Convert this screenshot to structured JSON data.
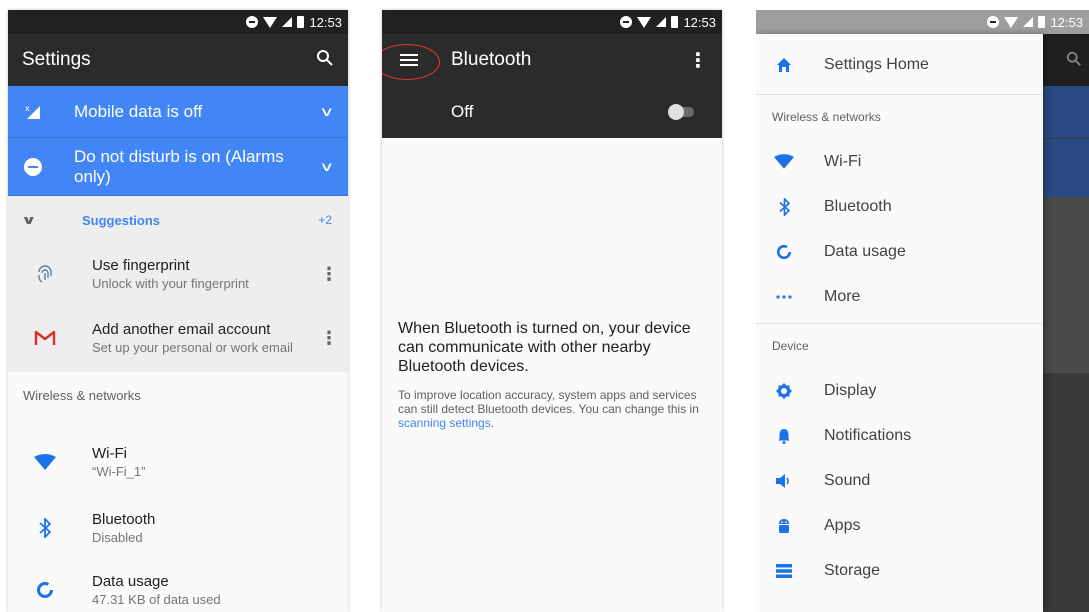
{
  "status_bar": {
    "time": "12:53"
  },
  "settings": {
    "title": "Settings",
    "conditions": [
      {
        "icon": "mobile-data-off-icon",
        "label": "Mobile data is off"
      },
      {
        "icon": "do-not-disturb-icon",
        "label": "Do not disturb is on (Alarms only)"
      }
    ],
    "suggestions": {
      "label": "Suggestions",
      "more_count": "+2",
      "items": [
        {
          "icon": "fingerprint-icon",
          "title": "Use fingerprint",
          "subtitle": "Unlock with your fingerprint"
        },
        {
          "icon": "gmail-icon",
          "title": "Add another email account",
          "subtitle": "Set up your personal or work email"
        }
      ]
    },
    "section_wireless": "Wireless & networks",
    "items": [
      {
        "icon": "wifi-icon",
        "title": "Wi-Fi",
        "subtitle": "“Wi-Fi_1”"
      },
      {
        "icon": "bluetooth-icon",
        "title": "Bluetooth",
        "subtitle": "Disabled"
      },
      {
        "icon": "data-usage-icon",
        "title": "Data usage",
        "subtitle": "47.31 KB of data used"
      }
    ]
  },
  "bluetooth": {
    "title": "Bluetooth",
    "switch_label": "Off",
    "switch_on": false,
    "message": "When Bluetooth is turned on, your device can communicate with other nearby Bluetooth devices.",
    "note_prefix": "To improve location accuracy, system apps and services can still detect Bluetooth devices. You can change this in ",
    "note_link": "scanning settings",
    "note_suffix": "."
  },
  "drawer": {
    "home": {
      "icon": "home-icon",
      "label": "Settings Home"
    },
    "section_wireless": "Wireless & networks",
    "wireless_items": [
      {
        "icon": "wifi-icon",
        "label": "Wi-Fi"
      },
      {
        "icon": "bluetooth-icon",
        "label": "Bluetooth"
      },
      {
        "icon": "data-usage-icon",
        "label": "Data usage"
      },
      {
        "icon": "more-icon",
        "label": "More"
      }
    ],
    "section_device": "Device",
    "device_items": [
      {
        "icon": "display-icon",
        "label": "Display"
      },
      {
        "icon": "notifications-icon",
        "label": "Notifications"
      },
      {
        "icon": "sound-icon",
        "label": "Sound"
      },
      {
        "icon": "apps-icon",
        "label": "Apps"
      },
      {
        "icon": "storage-icon",
        "label": "Storage"
      }
    ]
  },
  "colors": {
    "accent": "#4285f4",
    "toolbar": "#2b2b2b",
    "highlight_ring": "#e53935"
  }
}
